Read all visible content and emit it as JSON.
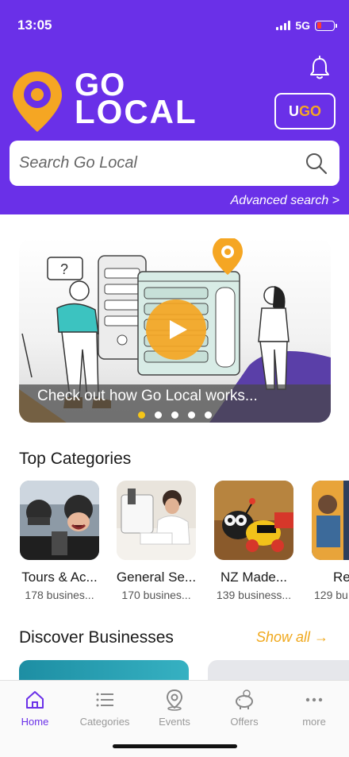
{
  "status_bar": {
    "time": "13:05",
    "network": "5G"
  },
  "header": {
    "logo_line1": "GO",
    "logo_line2": "LOCAL",
    "ugo_u": "U",
    "ugo_go": "GO",
    "search_placeholder": "Search Go Local",
    "advanced_search": "Advanced search >",
    "brand_color": "#6a30e8",
    "accent_color": "#f5a623"
  },
  "banner": {
    "caption": "Check out how Go Local works...",
    "slide_count": 5,
    "active_slide": 1
  },
  "top_categories": {
    "title": "Top Categories",
    "items": [
      {
        "name": "Tours & Ac...",
        "count": "178 busines..."
      },
      {
        "name": "General Se...",
        "count": "170 busines..."
      },
      {
        "name": "NZ Made...",
        "count": "139 business..."
      },
      {
        "name": "Re",
        "count": "129 bu"
      }
    ]
  },
  "discover": {
    "title": "Discover Businesses",
    "show_all": "Show all"
  },
  "bottom_nav": {
    "items": [
      {
        "label": "Home",
        "icon": "home-icon",
        "active": true
      },
      {
        "label": "Categories",
        "icon": "list-icon",
        "active": false
      },
      {
        "label": "Events",
        "icon": "location-pin-icon",
        "active": false
      },
      {
        "label": "Offers",
        "icon": "piggy-bank-icon",
        "active": false
      },
      {
        "label": "more",
        "icon": "more-dots-icon",
        "active": false
      }
    ]
  }
}
